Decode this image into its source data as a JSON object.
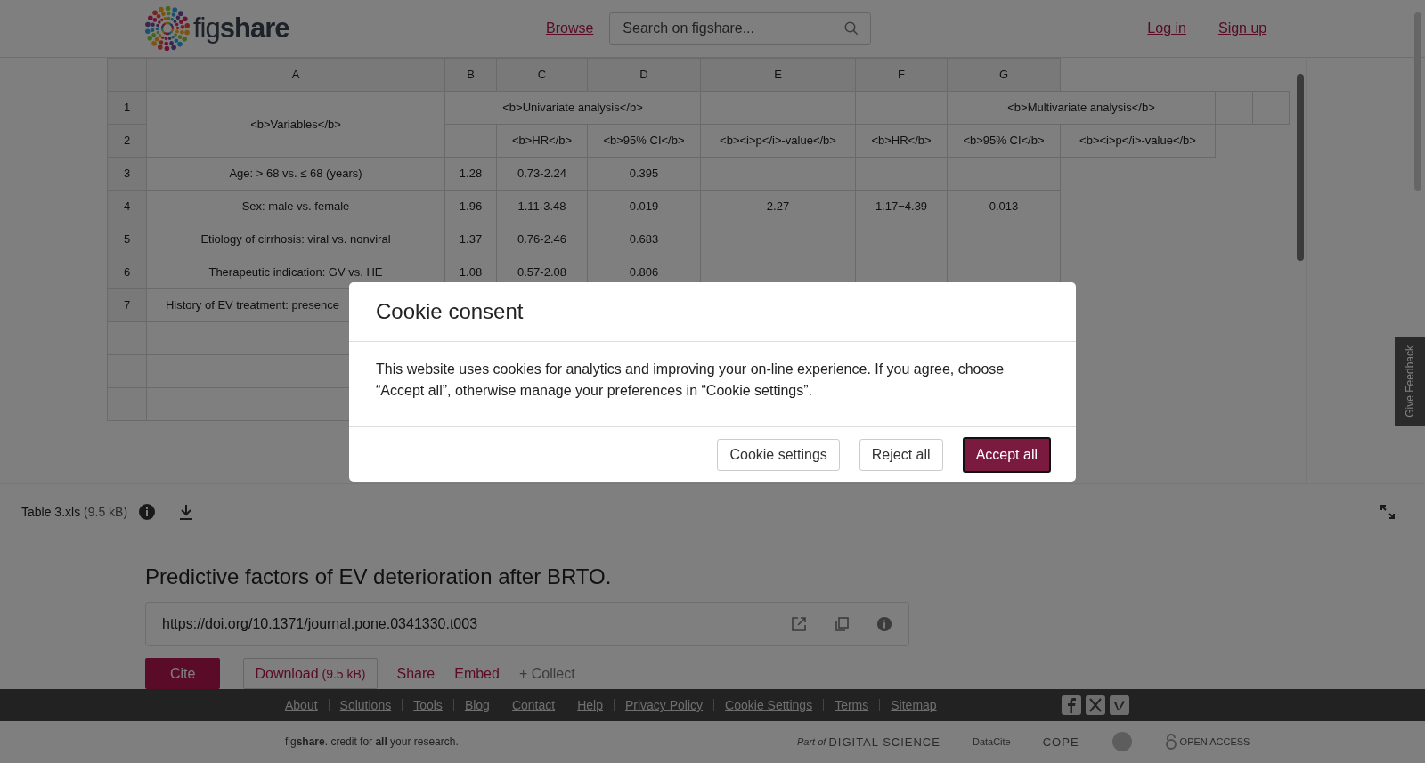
{
  "header": {
    "logo": "fig**share**",
    "browse": "Browse",
    "search": {
      "placeholder": "Search on figshare..."
    },
    "auth": [
      "Log in",
      "Sign up"
    ]
  },
  "spreadsheet": {
    "columns": [
      "A",
      "B",
      "C",
      "D",
      "E",
      "F",
      "G"
    ],
    "head": {
      "row_numbers": [
        "1",
        "2"
      ],
      "variables": "<b>Variables</b>",
      "univariate": "<b>Univariate analysis</b>",
      "multivariate": "<b>Multivariate analysis</b>",
      "subheaders": [
        "<b>HR</b>",
        "<b>95% CI</b>",
        "<b><i>p</i>-value</b>",
        "<b>HR</b>",
        "<b>95% CI</b>",
        "<b><i>p</i>-value</b>"
      ]
    },
    "rows": [
      {
        "number": "3",
        "kind": "full",
        "cells": [
          "Age: > 68 vs. ≤ 68 (years)",
          "1.28",
          "0.73-2.24",
          "0.395",
          null,
          null,
          null
        ]
      },
      {
        "number": "4",
        "kind": "full",
        "cells": [
          "Sex: male vs. female",
          "1.96",
          "1.11-3.48",
          "0.019",
          "2.27",
          "1.17−4.39",
          "0.013"
        ]
      },
      {
        "number": "5",
        "kind": "full",
        "cells": [
          "Etiology of cirrhosis: viral vs. nonviral",
          "1.37",
          "0.76-2.46",
          "0.683",
          null,
          null,
          null
        ]
      },
      {
        "number": "6",
        "kind": "full",
        "cells": [
          "Therapeutic indication: GV vs. HE",
          "1.08",
          "0.57-2.08",
          "0.806",
          null,
          null,
          null
        ]
      },
      {
        "number": "7",
        "kind": "cut",
        "cells": [
          "History of EV treatment: presence",
          null,
          null,
          null,
          null,
          null,
          null
        ]
      }
    ]
  },
  "file_bar": {
    "name": "Table 3.xls",
    "size": "(9.5 kB)"
  },
  "item": {
    "title": "Predictive factors of EV deterioration after BRTO.",
    "doi": "https://doi.org/10.1371/journal.pone.0341330.t003",
    "actions": [
      {
        "kind": "primary",
        "label": "Cite"
      },
      {
        "kind": "outline",
        "label": "Download",
        "size": "(9.5 kB)"
      },
      {
        "kind": "link",
        "label": "Share"
      },
      {
        "kind": "link",
        "label": "Embed"
      },
      {
        "kind": "muted",
        "label": "+ Collect"
      }
    ]
  },
  "feedback": "Give Feedback",
  "footer": {
    "links": [
      "About",
      "Solutions",
      "Tools",
      "Blog",
      "Contact",
      "Help",
      "Privacy Policy",
      "Cookie Settings",
      "Terms",
      "Sitemap"
    ],
    "tagline": "fig**share**. credit for **all** your research.",
    "partners": [
      {
        "kind": "digital_science",
        "label": "Part of",
        "name": "DIGITAL SCIENCE"
      },
      {
        "kind": "datacite",
        "name": "DataCite"
      },
      {
        "kind": "cope",
        "name": "COPE"
      },
      {
        "kind": "seal"
      },
      {
        "kind": "open_access",
        "name": "OPEN ACCESS"
      }
    ]
  },
  "cookie": {
    "title": "Cookie consent",
    "body": "This website uses cookies for analytics and improving your on-line experience. If you agree, choose “Accept all”, otherwise manage your preferences in “Cookie settings”.",
    "buttons": [
      {
        "kind": "secondary",
        "label": "Cookie settings"
      },
      {
        "kind": "secondary",
        "label": "Reject all"
      },
      {
        "kind": "primary",
        "label": "Accept all"
      }
    ]
  }
}
